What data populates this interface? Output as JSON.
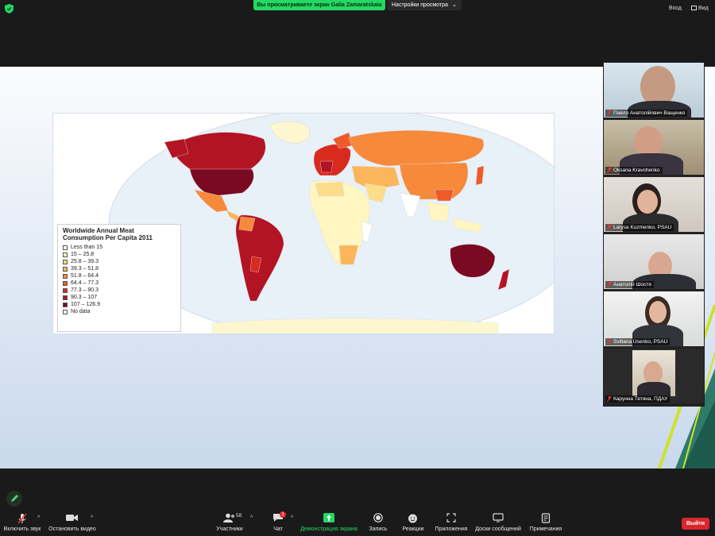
{
  "topbar": {
    "share_banner": "Вы просматриваете экран Galia Zamaratskaia",
    "view_options": "Настройки просмотра",
    "login": "Вход",
    "view": "Вид"
  },
  "slide": {
    "legend": {
      "title": "Worldwide Annual Meat Consumption Per Capita 2011",
      "items": [
        {
          "label": "Less than 15",
          "color": "#ffffff"
        },
        {
          "label": "15 – 25.8",
          "color": "#fff6c2"
        },
        {
          "label": "25.8 – 39.3",
          "color": "#fddc8a"
        },
        {
          "label": "39.3 – 51.8",
          "color": "#fbb55a"
        },
        {
          "label": "51.8 – 64.4",
          "color": "#f7893b"
        },
        {
          "label": "64.4 – 77.3",
          "color": "#ee5a28"
        },
        {
          "label": "77.3 – 90.3",
          "color": "#d92a1e"
        },
        {
          "label": "90.3 – 107",
          "color": "#b31424"
        },
        {
          "label": "107 – 126.9",
          "color": "#7a0a22"
        },
        {
          "label": "No data",
          "color": "#ffffff"
        }
      ]
    }
  },
  "participants": [
    {
      "name": "Павло Анатолійович Ващенко"
    },
    {
      "name": "Oksana Kravchenko"
    },
    {
      "name": "Larysa Kuzmenko, PSAU"
    },
    {
      "name": "Анатолій Шостя"
    },
    {
      "name": "Svitlana Usenko, PSAU"
    },
    {
      "name": "Карунна Тетяна, ПДАУ"
    }
  ],
  "toolbar": {
    "unmute": "Включить звук",
    "stop_video": "Остановить видео",
    "participants": "Участники",
    "participants_count": "58",
    "chat": "Чат",
    "chat_badge": "1",
    "share_screen": "Демонстрация экрана",
    "record": "Запись",
    "reactions": "Реакции",
    "apps": "Приложения",
    "whiteboards": "Доски сообщений",
    "notes": "Примечания",
    "leave": "Выйти"
  }
}
